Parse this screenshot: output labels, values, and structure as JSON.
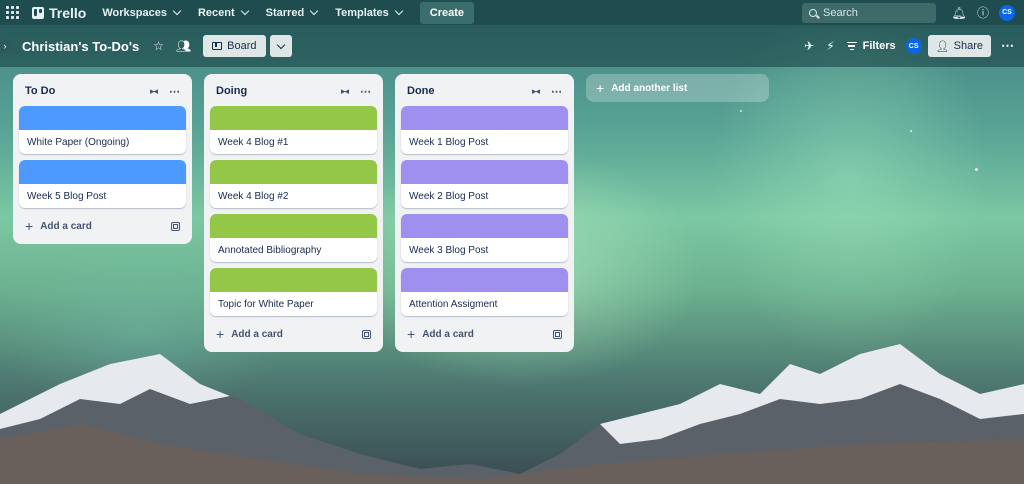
{
  "topnav": {
    "logo": "Trello",
    "items": [
      "Workspaces",
      "Recent",
      "Starred",
      "Templates"
    ],
    "create_label": "Create",
    "search_placeholder": "Search",
    "avatar_initials": "CS"
  },
  "board": {
    "title": "Christian's To-Do's",
    "view_label": "Board",
    "filters_label": "Filters",
    "member_initials": "CS",
    "share_label": "Share"
  },
  "lists": [
    {
      "title": "To Do",
      "cards": [
        {
          "title": "White Paper (Ongoing)",
          "cover": "#4c9aff"
        },
        {
          "title": "Week 5 Blog Post",
          "cover": "#4c9aff"
        }
      ],
      "add_card_label": "Add a card"
    },
    {
      "title": "Doing",
      "cards": [
        {
          "title": "Week 4 Blog #1",
          "cover": "#94c748"
        },
        {
          "title": "Week 4 Blog #2",
          "cover": "#94c748"
        },
        {
          "title": "Annotated Bibliography",
          "cover": "#94c748"
        },
        {
          "title": "Topic for White Paper",
          "cover": "#94c748"
        }
      ],
      "add_card_label": "Add a card"
    },
    {
      "title": "Done",
      "cards": [
        {
          "title": "Week 1 Blog Post",
          "cover": "#9f8fef"
        },
        {
          "title": "Week 2 Blog Post",
          "cover": "#9f8fef"
        },
        {
          "title": "Week 3 Blog Post",
          "cover": "#9f8fef"
        },
        {
          "title": "Attention Assigment",
          "cover": "#9f8fef"
        }
      ],
      "add_card_label": "Add a card"
    }
  ],
  "add_list_label": "Add another list",
  "colors": {
    "nav_bg": "#1f4d4f",
    "blue_label": "#4c9aff",
    "green_label": "#94c748",
    "purple_label": "#9f8fef"
  }
}
